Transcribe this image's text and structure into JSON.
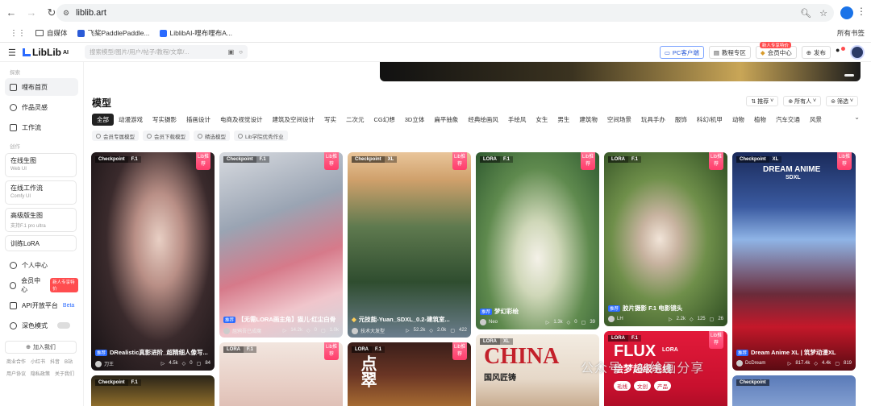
{
  "browser": {
    "url": "liblib.art",
    "bookmarks": [
      "自媒体",
      "飞桨PaddlePaddle...",
      "LiblibAI-哩布哩布A..."
    ],
    "all_bookmarks": "所有书签"
  },
  "header": {
    "logo": "LibLib",
    "logo_sup": "AI",
    "search_placeholder": "搜索模型/图片/用户/帖子/教程/文章/...",
    "pc_client": "PC客户端",
    "tutorial": "教程专区",
    "member": "会员中心",
    "member_badge": "新人专享特价",
    "publish": "发布"
  },
  "sidebar": {
    "section1": "探索",
    "items1": [
      "哩布首页",
      "作品灵感",
      "工作流"
    ],
    "section2": "创作",
    "tools": [
      {
        "label": "在线生图",
        "sub": "Web UI"
      },
      {
        "label": "在线工作流",
        "sub": "Comfy UI"
      },
      {
        "label": "高级版生图",
        "sub": "支持F.1 pro ultra"
      }
    ],
    "train": "训练LoRA",
    "personal": "个人中心",
    "member": "会员中心",
    "member_badge": "新人专享特价",
    "api": "API开放平台",
    "api_beta": "Beta",
    "dark": "深色模式",
    "join": "加入我们",
    "footer": [
      "商业合作",
      "小红书",
      "抖音",
      "B站",
      "用户协议",
      "隐私政策",
      "关于我们"
    ]
  },
  "main": {
    "section_title": "模型",
    "filter_sort": "推荐",
    "filter_people": "所有人",
    "filter_filter": "筛选",
    "categories": [
      "全部",
      "动漫游戏",
      "写实摄影",
      "插画设计",
      "电商及视觉设计",
      "建筑及空间设计",
      "写实",
      "二次元",
      "CG幻想",
      "3D立体",
      "扁平抽象",
      "经典绘画风",
      "手绘风",
      "女生",
      "男生",
      "建筑物",
      "空间场景",
      "玩具手办",
      "服饰",
      "科幻/机甲",
      "动物",
      "植物",
      "汽车交通",
      "风景"
    ],
    "quick_tags": [
      "会员专属模型",
      "会员下载模型",
      "精选模型",
      "Lib学院优秀作业"
    ]
  },
  "cards": [
    {
      "t1": "Checkpoint",
      "t2": "F.1",
      "rec": true,
      "badge": "推荐",
      "title": "DRealistic真影进阶_超精细人像写...",
      "user": "刀王",
      "s1": "4.5k",
      "s2": "0",
      "s3": "84"
    },
    {
      "t1": "Checkpoint",
      "t2": "F.1",
      "rec": true,
      "badge": "推荐",
      "title": "【无需LORA画主角】猫儿·红尘白骨",
      "user": "屈鸦吾已成魔",
      "s1": "14.2k",
      "s2": "0",
      "s3": "1.0k"
    },
    {
      "t1": "Checkpoint",
      "t2": "XL",
      "rec": true,
      "badge": "",
      "title": "元技能-Yuan_SDXL_0.2-建筑室...",
      "user": "技术大发型",
      "s1": "52.2k",
      "s2": "2.0k",
      "s3": "422"
    },
    {
      "t1": "LORA",
      "t2": "F.1",
      "rec": true,
      "badge": "推荐",
      "title": "梦幻彩绘",
      "user": "Neo",
      "s1": "1.3k",
      "s2": "0",
      "s3": "39"
    },
    {
      "t1": "LORA",
      "t2": "F.1",
      "rec": true,
      "badge": "推荐",
      "title": "胶片摄影 F.1 电影镜头",
      "user": "LH",
      "s1": "2.2k",
      "s2": "125",
      "s3": "26"
    },
    {
      "t1": "Checkpoint",
      "t2": "XL",
      "rec": true,
      "badge": "推荐",
      "title": "Dream Anime XL | 筑梦动漫XL",
      "user": "DcDream",
      "s1": "817.4k",
      "s2": "4.4k",
      "s3": "819"
    },
    {
      "t1": "Checkpoint",
      "t2": "F.1",
      "rec": false
    },
    {
      "t1": "LORA",
      "t2": "F.1",
      "rec": true
    },
    {
      "t1": "LORA",
      "t2": "F.1",
      "rec": true,
      "big": "点翠"
    },
    {
      "t1": "LORA",
      "t2": "XL",
      "rec": false,
      "big": "CHINA",
      "sub": "国风匠铸"
    },
    {
      "t1": "LORA",
      "t2": "F.1",
      "rec": true,
      "big": "FLUX",
      "sub": "绘梦超级毛线"
    },
    {
      "t1": "Checkpoint",
      "t2": "",
      "rec": false
    }
  ],
  "card_rec_label": "Lib推荐",
  "overlay_text": {
    "dream_title": "DREAM ANIME",
    "dream_sub": "SDXL",
    "flux_lora": "LORA",
    "flux_tags": [
      "毛线",
      "文创",
      "产品"
    ]
  },
  "watermark": "公众号 · AI绘画分享"
}
